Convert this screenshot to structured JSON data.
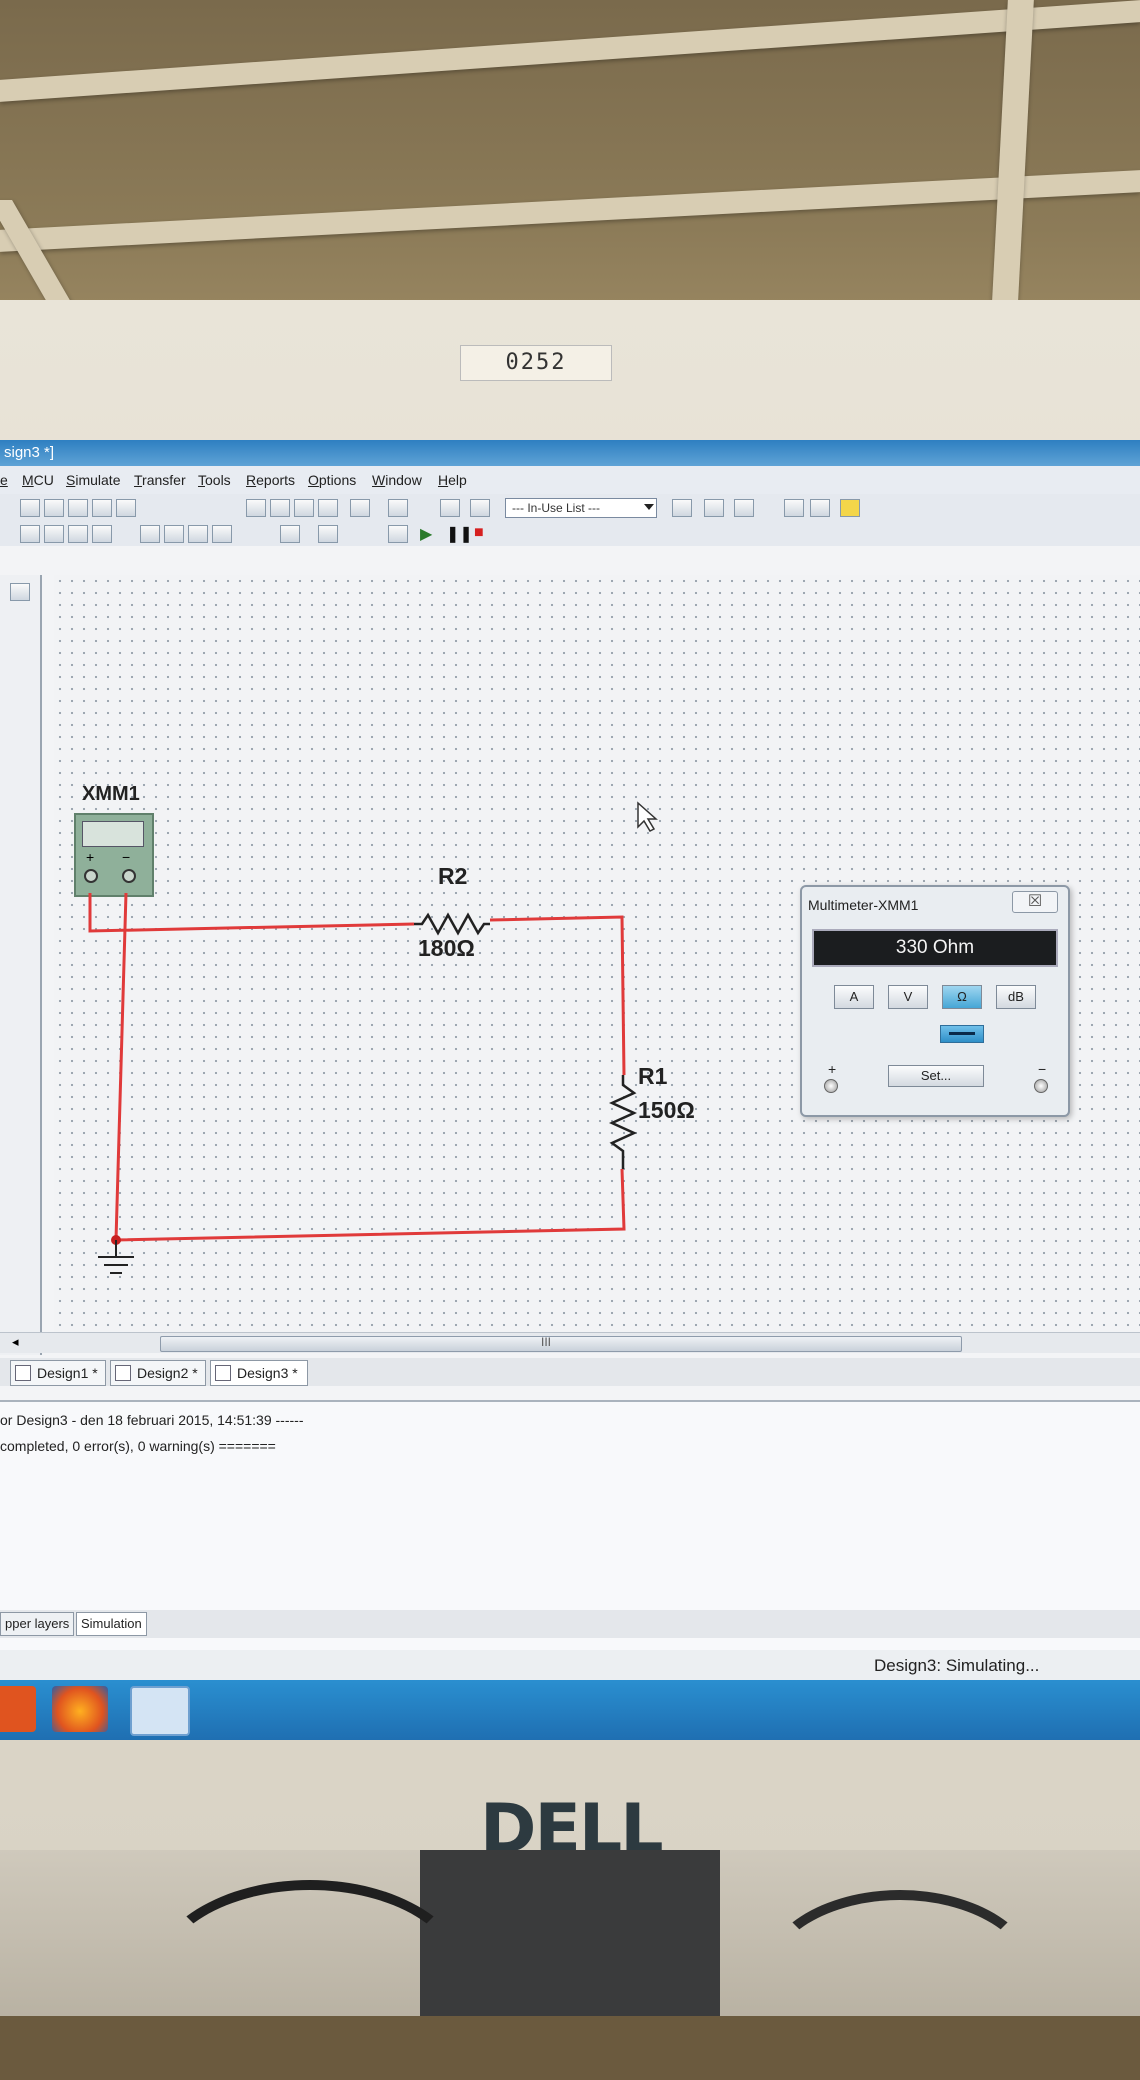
{
  "environment": {
    "asset_label": "0252",
    "monitor_brand": "DELL"
  },
  "window": {
    "title": "sign3 *]"
  },
  "menu": [
    "e",
    "MCU",
    "Simulate",
    "Transfer",
    "Tools",
    "Reports",
    "Options",
    "Window",
    "Help"
  ],
  "toolbar": {
    "in_use_list": "--- In-Use List ---"
  },
  "circuit": {
    "instrument_label": "XMM1",
    "r2_label": "R2",
    "r2_value": "180Ω",
    "r1_label": "R1",
    "r1_value": "150Ω",
    "wire_color": "#e03a3a"
  },
  "multimeter": {
    "title": "Multimeter-XMM1",
    "close": "☒",
    "reading": "330 Ohm",
    "buttons": [
      "A",
      "V",
      "Ω",
      "dB"
    ],
    "active_button": "Ω",
    "set_label": "Set...",
    "plus": "+",
    "minus": "−"
  },
  "scrollbar": {
    "grip": "III"
  },
  "design_tabs": [
    "Design1 *",
    "Design2 *",
    "Design3 *"
  ],
  "output": {
    "line1": "or Design3 - den 18 februari 2015, 14:51:39 ------",
    "line2": "completed, 0 error(s), 0 warning(s) ======="
  },
  "bottom_tabs": [
    "pper layers",
    "Simulation"
  ],
  "status": {
    "text": "Design3: Simulating..."
  }
}
